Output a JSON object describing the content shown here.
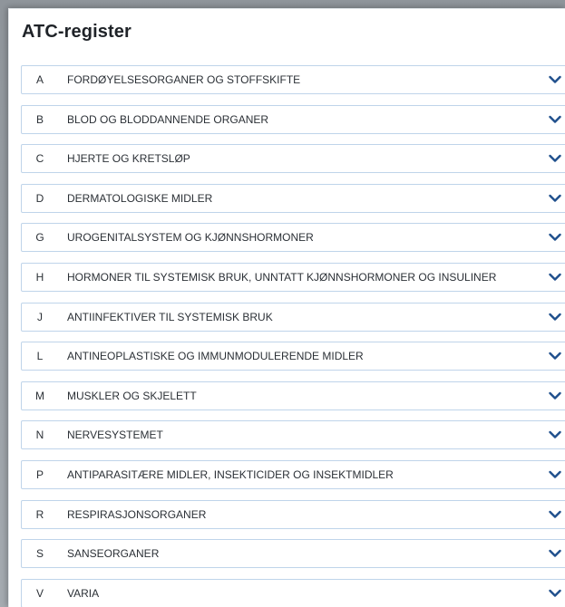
{
  "header": {
    "title": "ATC-register"
  },
  "colors": {
    "chevron": "#1f4f8c",
    "row_border": "#bfd4ea",
    "text": "#2b3036"
  },
  "rows": [
    {
      "code": "A",
      "label": "FORDØYELSESORGANER OG STOFFSKIFTE",
      "icon": "chevron-down-icon",
      "expanded": false
    },
    {
      "code": "B",
      "label": "BLOD OG BLODDANNENDE ORGANER",
      "icon": "chevron-down-icon",
      "expanded": false
    },
    {
      "code": "C",
      "label": "HJERTE OG KRETSLØP",
      "icon": "chevron-down-icon",
      "expanded": false
    },
    {
      "code": "D",
      "label": "DERMATOLOGISKE MIDLER",
      "icon": "chevron-down-icon",
      "expanded": false
    },
    {
      "code": "G",
      "label": "UROGENITALSYSTEM OG KJØNNSHORMONER",
      "icon": "chevron-down-icon",
      "expanded": false
    },
    {
      "code": "H",
      "label": "HORMONER TIL SYSTEMISK BRUK, UNNTATT KJØNNSHORMONER OG INSULINER",
      "icon": "chevron-down-icon",
      "expanded": false
    },
    {
      "code": "J",
      "label": "ANTIINFEKTIVER TIL SYSTEMISK BRUK",
      "icon": "chevron-down-icon",
      "expanded": false
    },
    {
      "code": "L",
      "label": "ANTINEOPLASTISKE OG IMMUNMODULERENDE MIDLER",
      "icon": "chevron-down-icon",
      "expanded": false
    },
    {
      "code": "M",
      "label": "MUSKLER OG SKJELETT",
      "icon": "chevron-down-icon",
      "expanded": false
    },
    {
      "code": "N",
      "label": "NERVESYSTEMET",
      "icon": "chevron-down-icon",
      "expanded": false
    },
    {
      "code": "P",
      "label": "ANTIPARASITÆRE MIDLER, INSEKTICIDER OG INSEKTMIDLER",
      "icon": "chevron-down-icon",
      "expanded": false
    },
    {
      "code": "R",
      "label": "RESPIRASJONSORGANER",
      "icon": "chevron-down-icon",
      "expanded": false
    },
    {
      "code": "S",
      "label": "SANSEORGANER",
      "icon": "chevron-down-icon",
      "expanded": false
    },
    {
      "code": "V",
      "label": "VARIA",
      "icon": "chevron-down-icon",
      "expanded": false
    }
  ]
}
